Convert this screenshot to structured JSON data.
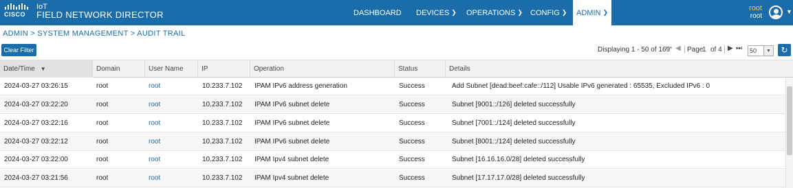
{
  "brand": {
    "logo_word": "CISCO",
    "product_line1": "IoT",
    "product_line2": "FIELD NETWORK DIRECTOR"
  },
  "nav": {
    "items": [
      {
        "label": "DASHBOARD",
        "dropdown": false,
        "active": false
      },
      {
        "label": "DEVICES",
        "dropdown": true,
        "active": false
      },
      {
        "label": "OPERATIONS",
        "dropdown": true,
        "active": false
      },
      {
        "label": "CONFIG",
        "dropdown": true,
        "active": false
      },
      {
        "label": "ADMIN",
        "dropdown": true,
        "active": true
      }
    ]
  },
  "user": {
    "name": "root",
    "role": "root",
    "avatar_icon": "user-avatar-icon"
  },
  "breadcrumb": "ADMIN > SYSTEM MANAGEMENT > AUDIT TRAIL",
  "toolbar": {
    "clear_filter_label": "Clear Filter",
    "display_text": "Displaying 1 - 50 of 169",
    "page_label": "Page",
    "page_current": "1",
    "page_of": "of 4",
    "page_size": "50"
  },
  "table": {
    "columns": [
      "Date/Time",
      "Domain",
      "User Name",
      "IP",
      "Operation",
      "Status",
      "Details"
    ],
    "sorted_column": "Date/Time",
    "sort_direction": "desc",
    "rows": [
      {
        "datetime": "2024-03-27 03:26:15",
        "domain": "root",
        "user": "root",
        "ip": "10.233.7.102",
        "operation": "IPAM IPv6 address generation",
        "status": "Success",
        "details": "Add Subnet [dead:beef:cafe::/112] Usable IPv6 generated : 65535, Excluded IPv6 : 0"
      },
      {
        "datetime": "2024-03-27 03:22:20",
        "domain": "root",
        "user": "root",
        "ip": "10.233.7.102",
        "operation": "IPAM IPv6 subnet delete",
        "status": "Success",
        "details": "Subnet [9001::/126] deleted successfully"
      },
      {
        "datetime": "2024-03-27 03:22:16",
        "domain": "root",
        "user": "root",
        "ip": "10.233.7.102",
        "operation": "IPAM IPv6 subnet delete",
        "status": "Success",
        "details": "Subnet [7001::/124] deleted successfully"
      },
      {
        "datetime": "2024-03-27 03:22:12",
        "domain": "root",
        "user": "root",
        "ip": "10.233.7.102",
        "operation": "IPAM IPv6 subnet delete",
        "status": "Success",
        "details": "Subnet [8001::/124] deleted successfully"
      },
      {
        "datetime": "2024-03-27 03:22:00",
        "domain": "root",
        "user": "root",
        "ip": "10.233.7.102",
        "operation": "IPAM Ipv4 subnet delete",
        "status": "Success",
        "details": "Subnet [16.16.16.0/28] deleted successfully"
      },
      {
        "datetime": "2024-03-27 03:21:56",
        "domain": "root",
        "user": "root",
        "ip": "10.233.7.102",
        "operation": "IPAM Ipv4 subnet delete",
        "status": "Success",
        "details": "Subnet [17.17.17.0/28] deleted successfully"
      }
    ]
  },
  "colors": {
    "brand_blue": "#1a6da8",
    "user_name": "#f0c24b",
    "header_bg": "#f2f2f2"
  }
}
